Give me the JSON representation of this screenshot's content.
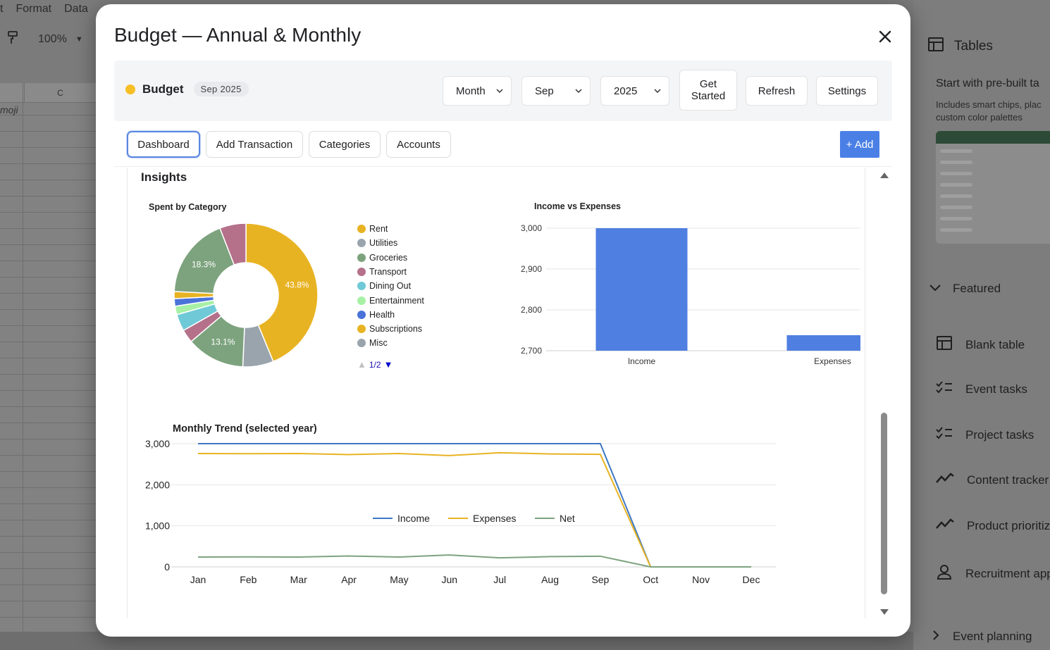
{
  "background": {
    "menu": [
      "t",
      "Format",
      "Data"
    ],
    "zoom": "100%",
    "column_header": "C",
    "cell_text": "moji",
    "side_panel": {
      "title": "Tables",
      "tagline": "Start with pre-built ta",
      "description_line1": "Includes smart chips, plac",
      "description_line2": "custom color palettes",
      "featured": "Featured",
      "items": [
        "Blank table",
        "Event tasks",
        "Project tasks",
        "Content tracker",
        "Product prioritiz",
        "Recruitment app"
      ],
      "more": "Event planning"
    }
  },
  "dialog": {
    "title": "Budget — Annual & Monthly",
    "brand": {
      "name": "Budget",
      "badge": "Sep 2025",
      "dot_color": "#f6bf26"
    },
    "selects": {
      "period": "Month",
      "month": "Sep",
      "year": "2025"
    },
    "buttons": {
      "get_started": "Get Started",
      "refresh": "Refresh",
      "settings": "Settings",
      "add": "+ Add"
    },
    "tabs": [
      "Dashboard",
      "Add Transaction",
      "Categories",
      "Accounts"
    ],
    "active_tab": "Dashboard",
    "insights_heading": "Insights",
    "pager": "1/2"
  },
  "chart_data": [
    {
      "type": "pie",
      "title": "Spent by Category",
      "donut": true,
      "categories": [
        "Rent",
        "Utilities",
        "Groceries",
        "Transport",
        "Dining Out",
        "Entertainment",
        "Health",
        "Subscriptions",
        "Misc"
      ],
      "values": [
        43.8,
        6.9,
        13.1,
        3.0,
        3.8,
        1.9,
        1.7,
        1.6,
        18.3,
        5.9
      ],
      "slices": [
        {
          "label": "Rent",
          "value": 43.8,
          "color": "#e8b323",
          "shown": "43.8%"
        },
        {
          "label": "Utilities",
          "value": 6.9,
          "color": "#9aa4ad",
          "shown": ""
        },
        {
          "label": "Groceries",
          "value": 13.1,
          "color": "#7da37e",
          "shown": "13.1%"
        },
        {
          "label": "Transport",
          "value": 3.0,
          "color": "#b5708a",
          "shown": ""
        },
        {
          "label": "Dining Out",
          "value": 3.8,
          "color": "#6fc9d6",
          "shown": ""
        },
        {
          "label": "Entertainment",
          "value": 1.9,
          "color": "#a7f0a6",
          "shown": ""
        },
        {
          "label": "Health",
          "value": 1.7,
          "color": "#4a73d9",
          "shown": ""
        },
        {
          "label": "Subscriptions",
          "value": 1.6,
          "color": "#e8b323",
          "shown": ""
        },
        {
          "label": "Misc",
          "value": 18.3,
          "color": "#7da37e",
          "shown": "18.3%"
        },
        {
          "label": "Misc",
          "value": 5.9,
          "color": "#b5708a",
          "shown": ""
        }
      ],
      "legend": [
        {
          "label": "Rent",
          "color": "#e8b323"
        },
        {
          "label": "Utilities",
          "color": "#9aa4ad"
        },
        {
          "label": "Groceries",
          "color": "#7da37e"
        },
        {
          "label": "Transport",
          "color": "#b5708a"
        },
        {
          "label": "Dining Out",
          "color": "#6fc9d6"
        },
        {
          "label": "Entertainment",
          "color": "#a7f0a6"
        },
        {
          "label": "Health",
          "color": "#4a73d9"
        },
        {
          "label": "Subscriptions",
          "color": "#e8b323"
        },
        {
          "label": "Misc",
          "color": "#9aa4ad"
        }
      ],
      "legend_position": "right"
    },
    {
      "type": "bar",
      "title": "Income vs Expenses",
      "categories": [
        "Income",
        "Expenses"
      ],
      "values": [
        3000,
        2738
      ],
      "ylim": [
        2700,
        3000
      ],
      "yticks": [
        2700,
        2800,
        2900,
        3000
      ],
      "color": "#4f7fe0",
      "grid": true
    },
    {
      "type": "line",
      "title": "Monthly Trend (selected year)",
      "categories": [
        "Jan",
        "Feb",
        "Mar",
        "Apr",
        "May",
        "Jun",
        "Jul",
        "Aug",
        "Sep",
        "Oct",
        "Nov",
        "Dec"
      ],
      "series": [
        {
          "name": "Income",
          "color": "#3d78c2",
          "values": [
            3000,
            3000,
            3000,
            3000,
            3000,
            3000,
            3000,
            3000,
            3000,
            0,
            0,
            0
          ]
        },
        {
          "name": "Expenses",
          "color": "#e8b323",
          "values": [
            2760,
            2755,
            2760,
            2735,
            2760,
            2710,
            2780,
            2750,
            2740,
            0,
            0,
            0
          ]
        },
        {
          "name": "Net",
          "color": "#7da37e",
          "values": [
            240,
            245,
            240,
            265,
            240,
            290,
            220,
            250,
            260,
            0,
            0,
            0
          ]
        }
      ],
      "ylim": [
        0,
        3000
      ],
      "yticks": [
        0,
        1000,
        2000,
        3000
      ],
      "legend_position": "bottom",
      "grid": true
    }
  ]
}
